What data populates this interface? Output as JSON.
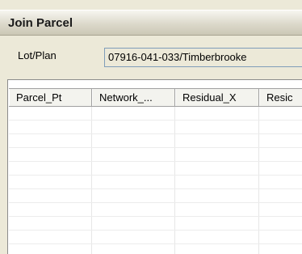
{
  "panel": {
    "title": "Join Parcel"
  },
  "lot": {
    "label": "Lot/Plan",
    "value": "07916-041-033/Timberbrooke"
  },
  "grid": {
    "columns": [
      "Parcel_Pt",
      "Network_...",
      "Residual_X",
      "Resic"
    ],
    "rows": [
      [
        "",
        "",
        "",
        ""
      ],
      [
        "",
        "",
        "",
        ""
      ],
      [
        "",
        "",
        "",
        ""
      ],
      [
        "",
        "",
        "",
        ""
      ],
      [
        "",
        "",
        "",
        ""
      ],
      [
        "",
        "",
        "",
        ""
      ],
      [
        "",
        "",
        "",
        ""
      ],
      [
        "",
        "",
        "",
        ""
      ],
      [
        "",
        "",
        "",
        ""
      ],
      [
        "",
        "",
        "",
        ""
      ],
      [
        "",
        "",
        "",
        ""
      ]
    ]
  }
}
